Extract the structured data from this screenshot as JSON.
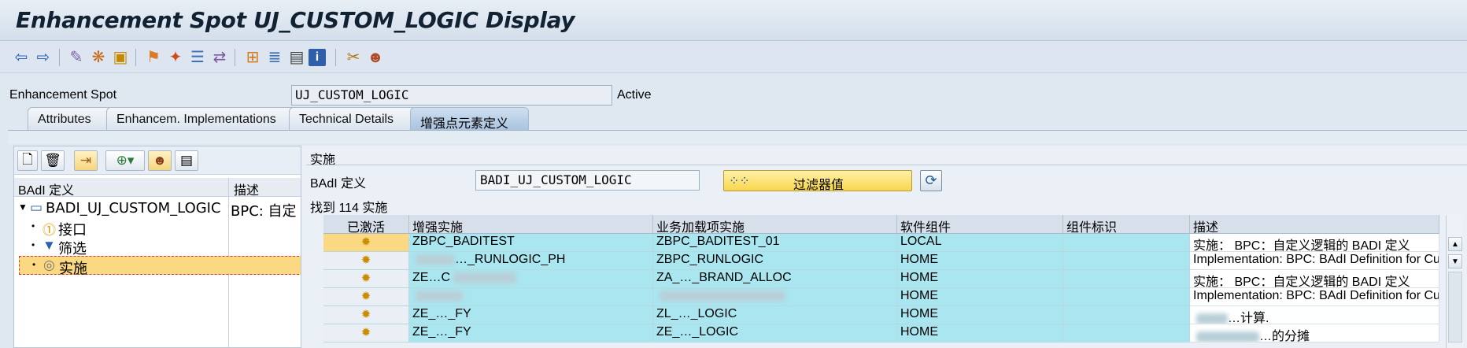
{
  "title": "Enhancement Spot UJ_CUSTOM_LOGIC Display",
  "toolbar": {
    "icons": [
      "back-icon",
      "forward-icon",
      "display-change-icon",
      "other-object-icon",
      "check-icon",
      "activate-icon",
      "where-used-icon",
      "object-list-icon",
      "navigate-icon",
      "hierarchy-icon",
      "tree-icon",
      "layout-icon",
      "info-icon",
      "enhance-icon",
      "users-icon"
    ]
  },
  "header": {
    "spot_label": "Enhancement Spot",
    "spot_value": "UJ_CUSTOM_LOGIC",
    "status": "Active"
  },
  "tabs": [
    {
      "label": "Attributes"
    },
    {
      "label": "Enhancem. Implementations"
    },
    {
      "label": "Technical Details"
    },
    {
      "label": "增强点元素定义"
    }
  ],
  "tree": {
    "col_name": "BAdI 定义",
    "col_desc": "描述",
    "root": {
      "label": "BADI_UJ_CUSTOM_LOGIC",
      "desc": "BPC: 自定"
    },
    "children": [
      {
        "label": "接口"
      },
      {
        "label": "筛选"
      },
      {
        "label": "实施"
      }
    ]
  },
  "right": {
    "title": "实施",
    "badi_label": "BAdI 定义",
    "badi_value": "BADI_UJ_CUSTOM_LOGIC",
    "filter_label": "过滤器值",
    "count_text": "找到 114 实施"
  },
  "grid": {
    "columns": [
      "已激活",
      "增强实施",
      "业务加载项实施",
      "软件组件",
      "组件标识",
      "描述"
    ],
    "rows": [
      {
        "impl": "ZBPC_BADITEST",
        "badi_impl": "ZBPC_BADITEST_01",
        "component": "LOCAL",
        "comp_id": "",
        "desc": "实施： BPC：自定义逻辑的 BADI 定义"
      },
      {
        "impl": "…_RUNLOGIC_PH",
        "badi_impl": "ZBPC_RUNLOGIC",
        "component": "HOME",
        "comp_id": "",
        "desc": "Implementation: BPC: BAdI Definition for Cu"
      },
      {
        "impl": "ZE…C",
        "badi_impl": "ZA_…_BRAND_ALLOC",
        "component": "HOME",
        "comp_id": "",
        "desc": "实施： BPC：自定义逻辑的 BADI 定义"
      },
      {
        "impl": "",
        "badi_impl": "",
        "component": "HOME",
        "comp_id": "",
        "desc": "Implementation: BPC: BAdI Definition for Cu"
      },
      {
        "impl": "ZE_…_FY",
        "badi_impl": "ZL_…_LOGIC",
        "component": "HOME",
        "comp_id": "",
        "desc": "…计算."
      },
      {
        "impl": "ZE_…_FY",
        "badi_impl": "ZE_…_LOGIC",
        "component": "HOME",
        "comp_id": "",
        "desc": "…的分摊"
      }
    ]
  }
}
